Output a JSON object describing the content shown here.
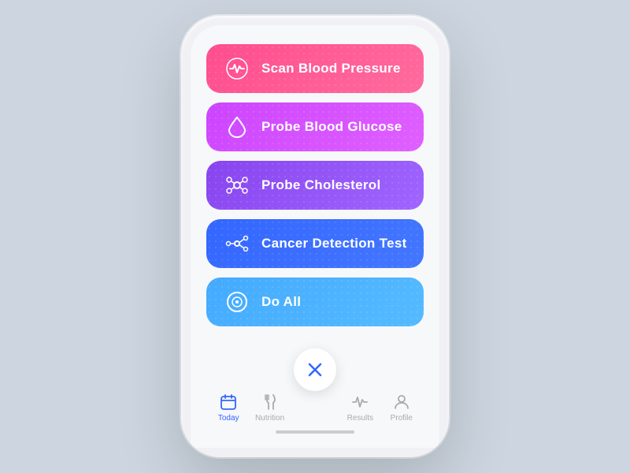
{
  "buttons": [
    {
      "id": "scan-blood-pressure",
      "label": "Scan Blood Pressure",
      "icon": "heartbeat",
      "colorClass": "btn-scan-blood"
    },
    {
      "id": "probe-blood-glucose",
      "label": "Probe Blood Glucose",
      "icon": "droplet",
      "colorClass": "btn-blood-glucose"
    },
    {
      "id": "probe-cholesterol",
      "label": "Probe Cholesterol",
      "icon": "molecule",
      "colorClass": "btn-cholesterol"
    },
    {
      "id": "cancer-detection",
      "label": "Cancer Detection Test",
      "icon": "network",
      "colorClass": "btn-cancer"
    },
    {
      "id": "do-all",
      "label": "Do All",
      "icon": "target",
      "colorClass": "btn-do-all"
    }
  ],
  "nav": {
    "items": [
      {
        "id": "today",
        "label": "Today",
        "icon": "calendar",
        "active": true
      },
      {
        "id": "nutrition",
        "label": "Nutrition",
        "icon": "fork-knife",
        "active": false
      },
      {
        "id": "fab",
        "label": "",
        "icon": "close",
        "active": false
      },
      {
        "id": "results",
        "label": "Results",
        "icon": "activity",
        "active": false
      },
      {
        "id": "profile",
        "label": "Profile",
        "icon": "person",
        "active": false
      }
    ]
  }
}
